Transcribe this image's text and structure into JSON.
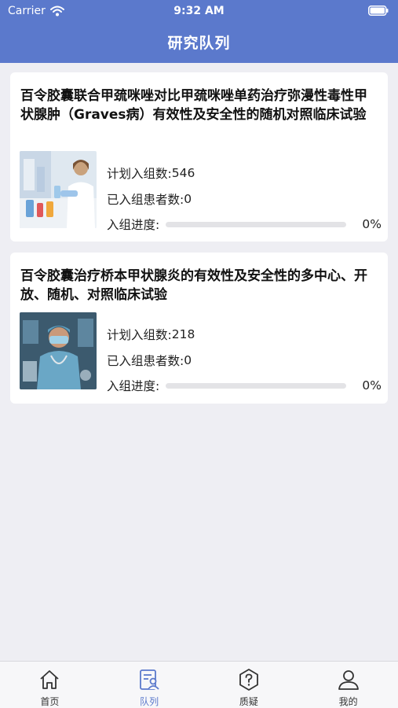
{
  "status_bar": {
    "carrier": "Carrier",
    "time": "9:32 AM"
  },
  "nav": {
    "title": "研究队列"
  },
  "labels": {
    "planned": "计划入组数: ",
    "enrolled": "已入组患者数: ",
    "progress": "入组进度:"
  },
  "studies": [
    {
      "title": "百令胶囊联合甲巯咪唑对比甲巯咪唑单药治疗弥漫性毒性甲状腺肿（Graves病）有效性及安全性的随机对照临床试验",
      "planned_value": "546",
      "enrolled_value": "0",
      "progress_text": "0%",
      "progress": 0,
      "image_icon": "lab-scientist-photo"
    },
    {
      "title": "百令胶囊治疗桥本甲状腺炎的有效性及安全性的多中心、开放、随机、对照临床试验",
      "planned_value": "218",
      "enrolled_value": "0",
      "progress_text": "0%",
      "progress": 0,
      "image_icon": "doctor-photo"
    }
  ],
  "tabs": [
    {
      "label": "首页",
      "icon": "home-icon"
    },
    {
      "label": "队列",
      "icon": "cohort-icon",
      "active": true
    },
    {
      "label": "质疑",
      "icon": "question-icon"
    },
    {
      "label": "我的",
      "icon": "user-icon"
    }
  ],
  "colors": {
    "primary": "#5b79cc",
    "background": "#eeeef3",
    "track": "#e3e3e6"
  }
}
